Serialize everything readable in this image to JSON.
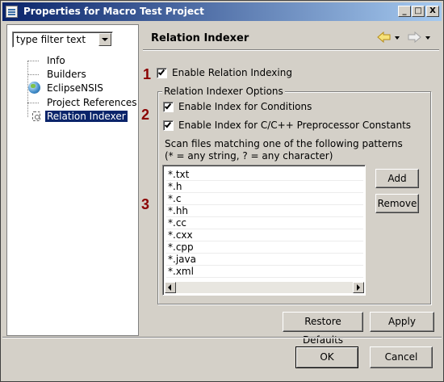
{
  "window": {
    "title": "Properties for Macro Test Project",
    "controls": {
      "minimize": "_",
      "maximize": "□",
      "close": "X"
    }
  },
  "filter": {
    "value": "type filter text"
  },
  "tree": {
    "items": [
      {
        "label": "Info",
        "icon": "none",
        "selected": false
      },
      {
        "label": "Builders",
        "icon": "none",
        "selected": false
      },
      {
        "label": "EclipseNSIS",
        "icon": "globe-icon",
        "selected": false
      },
      {
        "label": "Project References",
        "icon": "none",
        "selected": false
      },
      {
        "label": "Relation Indexer",
        "icon": "relation-indexer-icon",
        "selected": true
      }
    ]
  },
  "page": {
    "title": "Relation Indexer",
    "nav": {
      "back_icon": "back-arrow-icon",
      "forward_icon": "forward-arrow-icon"
    }
  },
  "markers": [
    "1",
    "2",
    "3"
  ],
  "enable_indexing": {
    "label": "Enable Relation Indexing",
    "checked": true
  },
  "options": {
    "legend": "Relation Indexer Options",
    "conditions": {
      "label": "Enable Index for Conditions",
      "checked": true
    },
    "preprocessor": {
      "label": "Enable Index for C/C++ Preprocessor Constants",
      "checked": true
    },
    "scan_line1": "Scan files matching one of the following patterns",
    "scan_line2": "(* = any string, ? = any character)",
    "patterns": [
      "*.txt",
      "*.h",
      "*.c",
      "*.hh",
      "*.cc",
      "*.cxx",
      "*.cpp",
      "*.java",
      "*.xml"
    ],
    "add_label": "Add",
    "remove_label": "Remove"
  },
  "buttons": {
    "restore_defaults": "Restore Defaults",
    "apply": "Apply",
    "ok": "OK",
    "cancel": "Cancel"
  },
  "colors": {
    "selection": "#0a246a",
    "marker": "#8b0000",
    "title_gradient_start": "#0a246a",
    "title_gradient_end": "#a6caf0"
  }
}
